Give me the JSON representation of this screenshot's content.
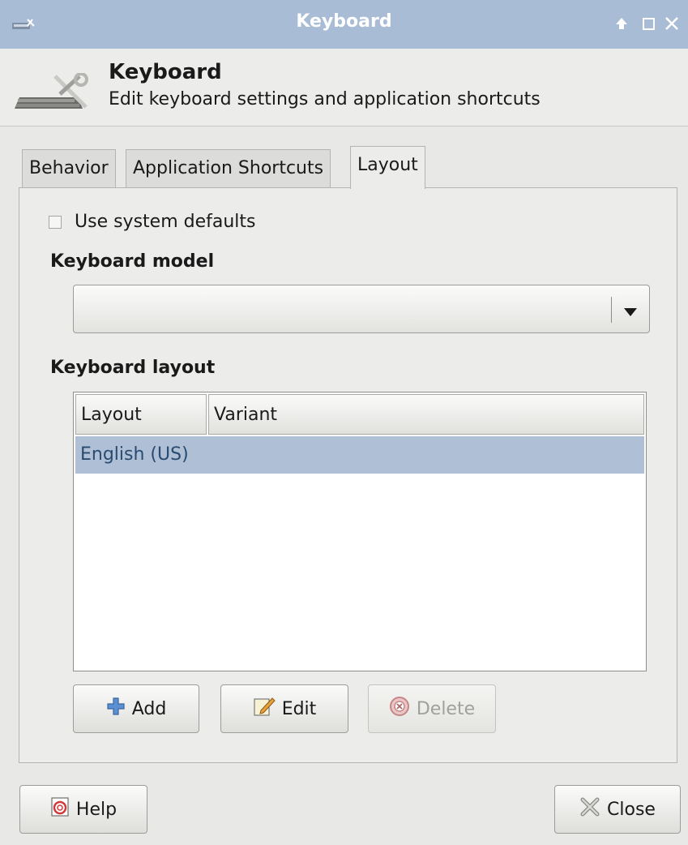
{
  "window": {
    "title": "Keyboard",
    "controls": [
      "minimize-arrow",
      "maximize",
      "close"
    ]
  },
  "header": {
    "title": "Keyboard",
    "subtitle": "Edit keyboard settings and application shortcuts"
  },
  "tabs": [
    {
      "label": "Behavior",
      "active": false
    },
    {
      "label": "Application Shortcuts",
      "active": false
    },
    {
      "label": "Layout",
      "active": true
    }
  ],
  "layout_tab": {
    "use_system_defaults": {
      "label": "Use system defaults",
      "checked": false
    },
    "keyboard_model": {
      "label": "Keyboard model",
      "value": ""
    },
    "keyboard_layout": {
      "label": "Keyboard layout",
      "columns": [
        "Layout",
        "Variant"
      ],
      "rows": [
        {
          "layout": "English (US)",
          "variant": "",
          "selected": true
        }
      ]
    },
    "buttons": {
      "add": "Add",
      "edit": "Edit",
      "delete": "Delete"
    }
  },
  "footer": {
    "help": "Help",
    "close": "Close"
  },
  "colors": {
    "titlebar": "#a9bcd6",
    "selection": "#aebfd6",
    "background": "#ececea"
  }
}
